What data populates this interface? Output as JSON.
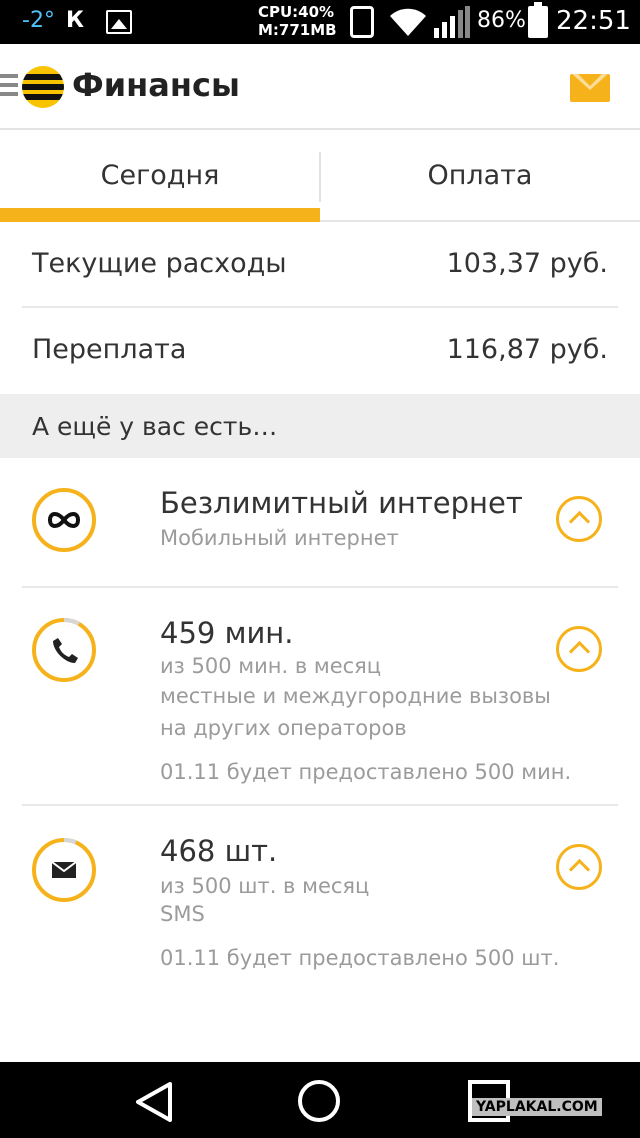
{
  "statusbar": {
    "temperature": "-2°",
    "k": "К",
    "cpu": "CPU:40%",
    "mem": "M:771MB",
    "battery": "86%",
    "time": "22:51"
  },
  "appbar": {
    "title": "Финансы"
  },
  "tabs": [
    {
      "label": "Сегодня",
      "active": true
    },
    {
      "label": "Оплата",
      "active": false
    }
  ],
  "summary": [
    {
      "label": "Текущие расходы",
      "value": "103,37 руб."
    },
    {
      "label": "Переплата",
      "value": "116,87 руб."
    }
  ],
  "section_header": "А ещё у вас есть…",
  "services": [
    {
      "title": "Безлимитный интернет",
      "lines": [
        "Мобильный интернет"
      ],
      "icon": "infinity-icon"
    },
    {
      "title": "459 мин.",
      "lines": [
        "из 500 мин. в месяц",
        "местные и междугородние вызовы",
        "на других операторов"
      ],
      "note": "01.11 будет предоставлено 500 мин.",
      "icon": "phone-icon",
      "remaining_fraction": 0.918
    },
    {
      "title": "468 шт.",
      "lines": [
        "из 500 шт. в месяц",
        "SMS"
      ],
      "note": "01.11 будет предоставлено 500 шт.",
      "icon": "envelope-icon",
      "remaining_fraction": 0.936
    }
  ],
  "watermark": "YAPLAKAL.COM",
  "colors": {
    "accent": "#f6b21b",
    "text": "#333333",
    "muted": "#9b9b9b",
    "section_bg": "#eeeeee"
  }
}
